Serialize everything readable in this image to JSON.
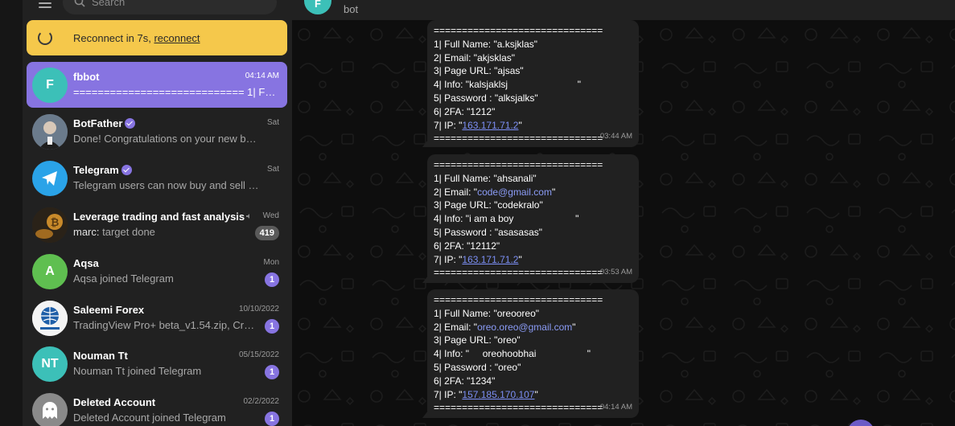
{
  "search": {
    "placeholder": "Search"
  },
  "reconnect": {
    "prefix": "Reconnect in 7s, ",
    "link": "reconnect"
  },
  "chats": [
    {
      "name": "fbbot",
      "initial": "F",
      "time": "04:14 AM",
      "preview": "============================ 1| Full Name: \"oreooreo\"",
      "color": "#3cc0b8"
    },
    {
      "name": "BotFather",
      "time": "Sat",
      "preview": "Done! Congratulations on your new bot. You will find it at t.me/",
      "verified": true
    },
    {
      "name": "Telegram",
      "time": "Sat",
      "preview": "Telegram users can now buy and sell shares",
      "verified": true
    },
    {
      "name": "Leverage trading and fast analysis",
      "time": "Wed",
      "preview_sender": "marc:",
      "preview": "target done",
      "badge": "419"
    },
    {
      "name": "Aqsa",
      "initial": "A",
      "time": "Mon",
      "preview": "Aqsa joined Telegram",
      "badge": "1",
      "color": "#5fbf50"
    },
    {
      "name": "Saleemi Forex",
      "time": "10/10/2022",
      "preview": "TradingView Pro+ beta_v1.54.zip, Crack",
      "badge": "1"
    },
    {
      "name": "Nouman Tt",
      "initial": "NT",
      "time": "05/15/2022",
      "preview": "Nouman Tt joined Telegram",
      "badge": "1",
      "color": "#3cc0b8"
    },
    {
      "name": "Deleted Account",
      "time": "02/2/2022",
      "preview": "Deleted Account joined Telegram",
      "badge": "1",
      "color": "#8a8a8a"
    }
  ],
  "header": {
    "initial": "F",
    "subtitle": "bot"
  },
  "messages": [
    {
      "sep": "==============================",
      "name": "1| Full Name: \"a.ksjklas\"",
      "email_prefix": "2| Email: \"",
      "email": "akjsklas",
      "email_suffix": "\"",
      "page": "3| Page URL: \"ajsas\"",
      "info": "4| Info: \"kalsjaklsj                          \"",
      "password": "5| Password : \"alksjalks\"",
      "twofa": "6| 2FA: \"1212\"",
      "ip_prefix": "7| IP: \"",
      "ip": "163.171.71.2",
      "ip_suffix": "\"",
      "time": "03:44 AM"
    },
    {
      "sep": "==============================",
      "name": "1| Full Name: \"ahsanali\"",
      "email_prefix": "2| Email: \"",
      "email": "code@gmail.com",
      "email_suffix": "\"",
      "page": "3| Page URL: \"codekralo\"",
      "info": "4| Info: \"i am a boy                       \"",
      "password": "5| Password : \"asasasas\"",
      "twofa": "6| 2FA: \"12112\"",
      "ip_prefix": "7| IP: \"",
      "ip": "163.171.71.2",
      "ip_suffix": "\"",
      "time": "03:53 AM"
    },
    {
      "sep": "==============================",
      "name": "1| Full Name: \"oreooreo\"",
      "email_prefix": "2| Email: \"",
      "email": "oreo.oreo@gmail.com",
      "email_suffix": "\"",
      "page": "3| Page URL: \"oreo\"",
      "info": "4| Info: \"     oreohoobhai                   \"",
      "password": "5| Password : \"oreo\"",
      "twofa": "6| 2FA: \"1234\"",
      "ip_prefix": "7| IP: \"",
      "ip": "157.185.170.107",
      "ip_suffix": "\"",
      "time": "04:14 AM"
    }
  ],
  "colors": {
    "accent": "#8774e1",
    "banner": "#f5c84b",
    "link": "#7c8ff5"
  }
}
